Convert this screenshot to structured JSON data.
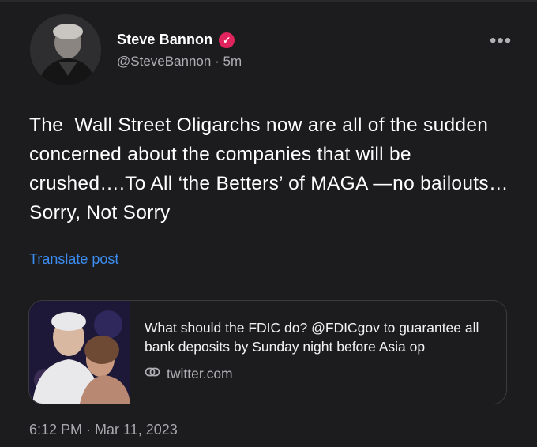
{
  "author": {
    "name": "Steve Bannon",
    "handle": "@SteveBannon",
    "separator": "·",
    "relative_time": "5m",
    "verified_icon": "verified-badge-icon",
    "verified_color": "#e0245e"
  },
  "post": {
    "text": "The  Wall Street Oligarchs now are all of the sudden concerned about the companies that will be crushed….To All ‘the Betters’ of MAGA —no bailouts…Sorry, Not Sorry",
    "translate_label": "Translate post",
    "timestamp": "6:12 PM · Mar 11, 2023"
  },
  "card": {
    "text": "What should the FDIC do? @FDICgov to guarantee all bank deposits by Sunday night before Asia op",
    "link_icon": "link-icon",
    "domain": "twitter.com"
  },
  "colors": {
    "background": "#1c1c1e",
    "link": "#3b8df1",
    "secondary_text": "#b0b0b4"
  }
}
